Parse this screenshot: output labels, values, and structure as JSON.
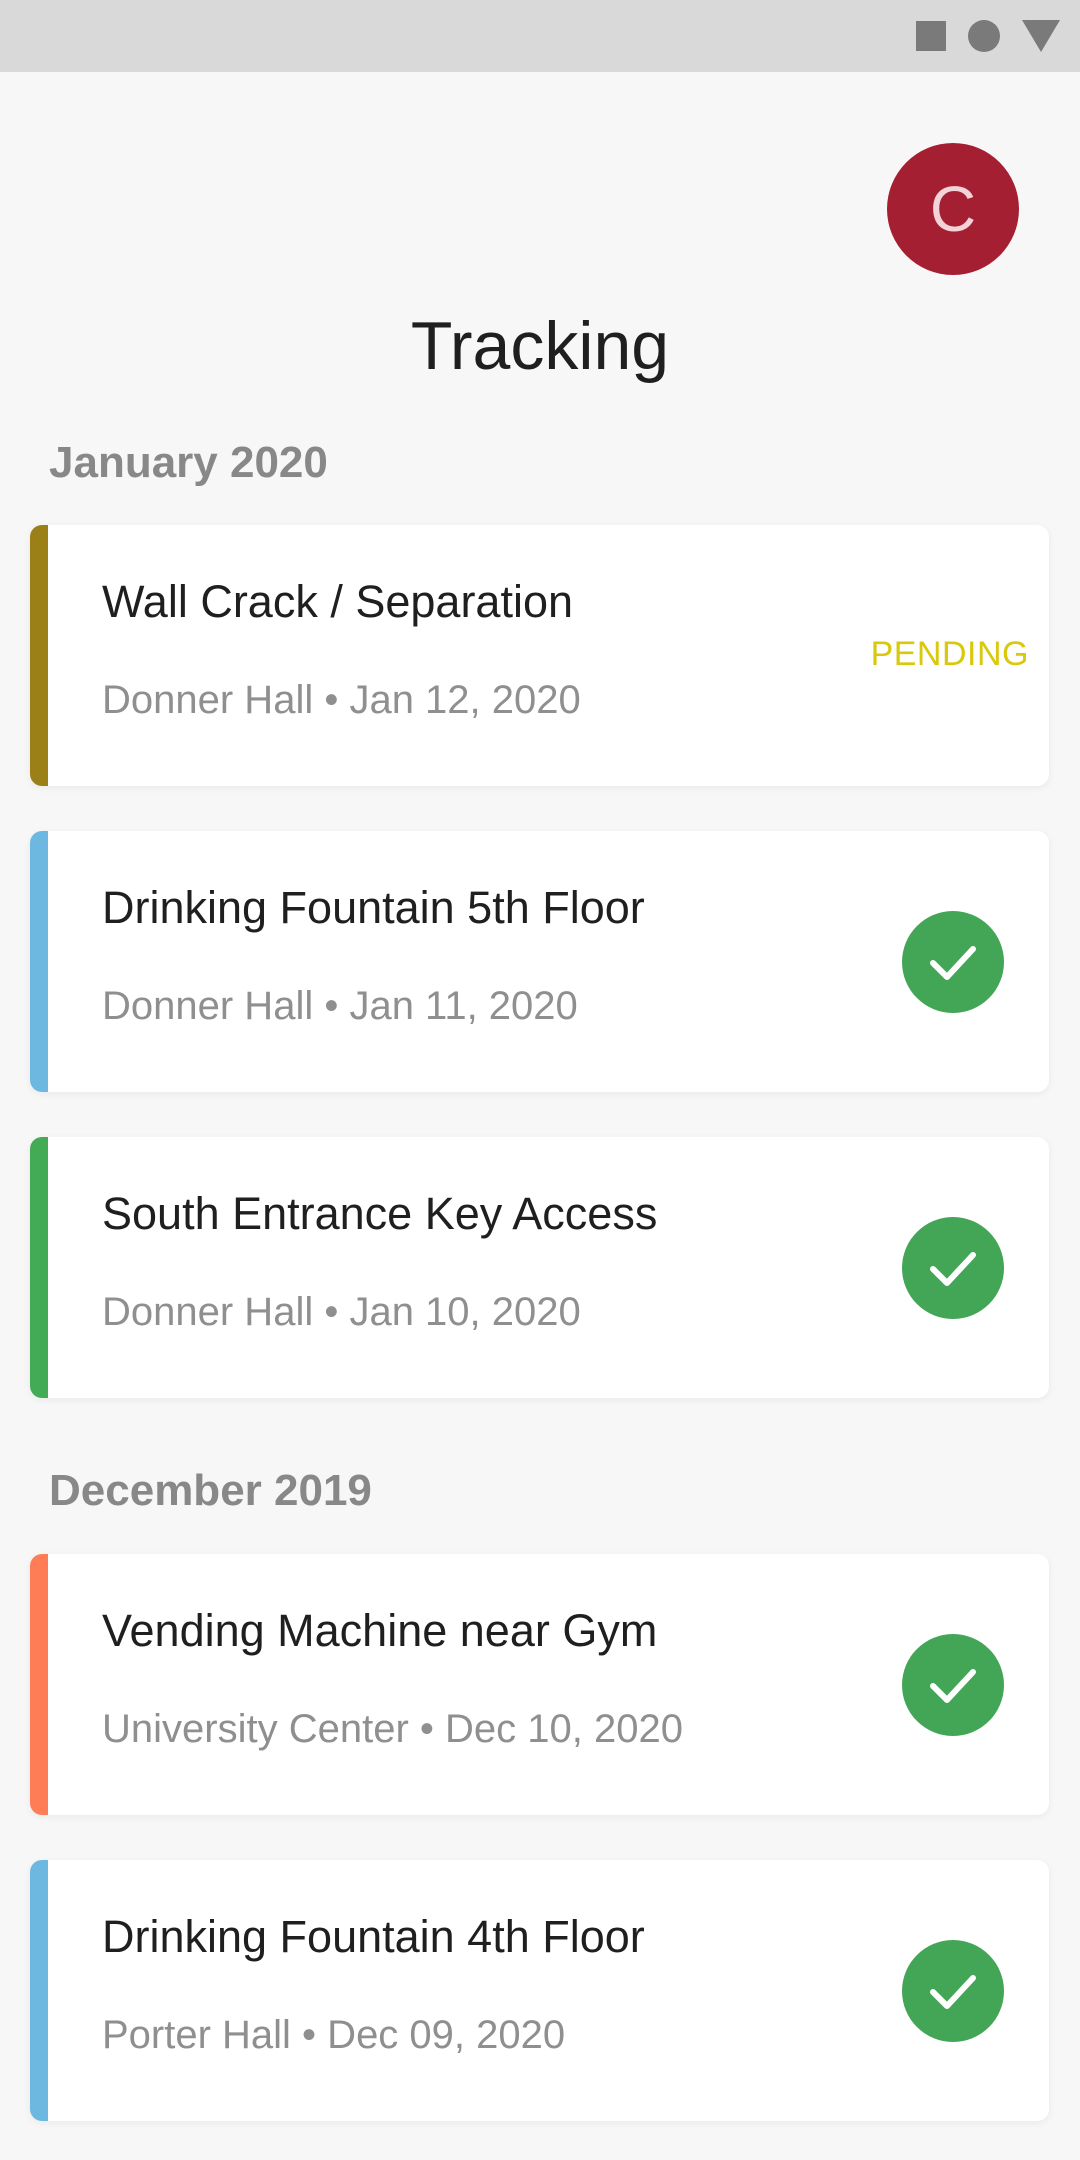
{
  "status_bar": {
    "icons": [
      "square-icon",
      "circle-icon",
      "triangle-icon"
    ]
  },
  "header": {
    "avatar_initial": "C",
    "avatar_color": "#a51f33",
    "title": "Tracking"
  },
  "sections": [
    {
      "heading": "January 2020",
      "items": [
        {
          "title": "Wall Crack / Separation",
          "meta": "Donner Hall • Jan 12, 2020",
          "accent": "#9b7f17",
          "status": "PENDING"
        },
        {
          "title": "Drinking Fountain 5th Floor",
          "meta": "Donner Hall • Jan 11, 2020",
          "accent": "#6cb8e0",
          "status": "completed"
        },
        {
          "title": "South Entrance Key Access",
          "meta": "Donner Hall • Jan 10, 2020",
          "accent": "#43ab55",
          "status": "completed"
        }
      ]
    },
    {
      "heading": "December 2019",
      "items": [
        {
          "title": "Vending Machine near Gym",
          "meta": "University Center • Dec 10, 2020",
          "accent": "#ff7d56",
          "status": "completed"
        },
        {
          "title": "Drinking Fountain 4th Floor",
          "meta": "Porter Hall • Dec 09, 2020",
          "accent": "#6cb8e0",
          "status": "completed"
        }
      ]
    }
  ],
  "colors": {
    "pending": "#d9c80c",
    "completed": "#43a656"
  }
}
